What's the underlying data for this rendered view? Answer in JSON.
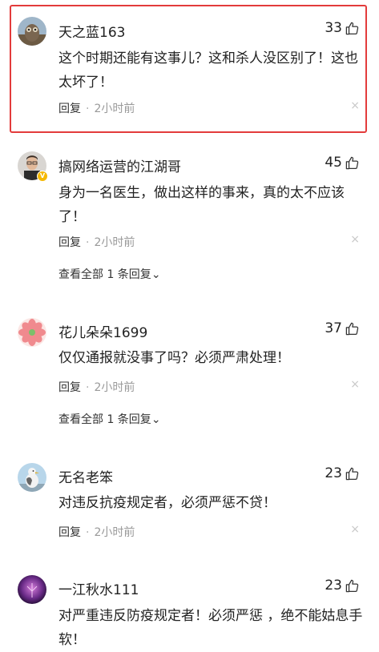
{
  "comments": [
    {
      "author": "天之蓝163",
      "likes": "33",
      "text": "这个时期还能有这事儿？这和杀人没区别了！这也太坏了！",
      "reply_label": "回复",
      "separator": "·",
      "time": "2小时前",
      "close_glyph": "×"
    },
    {
      "author": "搞网络运营的江湖哥",
      "likes": "45",
      "text": "身为一名医生，做出这样的事来，真的太不应该了！",
      "reply_label": "回复",
      "separator": "·",
      "time": "2小时前",
      "close_glyph": "×",
      "badge": "V",
      "view_all": "查看全部 1 条回复",
      "view_all_arrow": "⌄"
    },
    {
      "author": "花儿朵朵1699",
      "likes": "37",
      "text": "仅仅通报就没事了吗？必须严肃处理！",
      "reply_label": "回复",
      "separator": "·",
      "time": "2小时前",
      "close_glyph": "×",
      "view_all": "查看全部 1 条回复",
      "view_all_arrow": "⌄"
    },
    {
      "author": "无名老笨",
      "likes": "23",
      "text": "对违反抗疫规定者，必须严惩不贷！",
      "reply_label": "回复",
      "separator": "·",
      "time": "2小时前",
      "close_glyph": "×"
    },
    {
      "author": "一江秋水111",
      "likes": "23",
      "text": "对严重违反防疫规定者！必须严惩 ，绝不能姑息手软！"
    }
  ],
  "icons": {
    "like": "thumbs-up-icon",
    "close": "close-icon",
    "chevron": "chevron-down-icon"
  },
  "colors": {
    "highlight_border": "#e33b3b",
    "verified_badge": "#f5b800",
    "time_text": "#9a9a9a"
  }
}
